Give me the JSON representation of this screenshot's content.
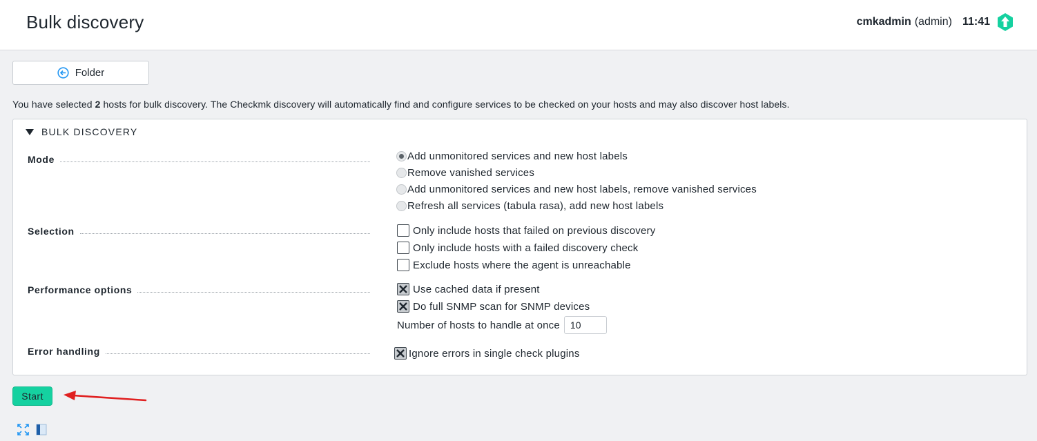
{
  "header": {
    "title": "Bulk discovery",
    "user_name": "cmkadmin",
    "user_role": "(admin)",
    "time": "11:41",
    "status_icon": "green-up-arrow-icon"
  },
  "toolbar": {
    "folder_label": "Folder",
    "folder_icon": "back-circle-icon"
  },
  "info": {
    "before": "You have selected ",
    "count": "2",
    "after": " hosts for bulk discovery. The Checkmk discovery will automatically find and configure services to be checked on your hosts and may also discover host labels."
  },
  "panel": {
    "title": "BULK DISCOVERY",
    "mode": {
      "label": "Mode",
      "options": [
        "Add unmonitored services and new host labels",
        "Remove vanished services",
        "Add unmonitored services and new host labels, remove vanished services",
        "Refresh all services (tabula rasa), add new host labels"
      ],
      "selected_index": 0
    },
    "selection": {
      "label": "Selection",
      "options": [
        "Only include hosts that failed on previous discovery",
        "Only include hosts with a failed discovery check",
        "Exclude hosts where the agent is unreachable"
      ],
      "checked": [
        false,
        false,
        false
      ]
    },
    "performance": {
      "label": "Performance options",
      "options": [
        "Use cached data if present",
        "Do full SNMP scan for SNMP devices"
      ],
      "checked": [
        true,
        true
      ],
      "hosts_at_once_label": "Number of hosts to handle at once",
      "hosts_at_once_value": "10"
    },
    "error_handling": {
      "label": "Error handling",
      "option": "Ignore errors in single check plugins",
      "checked": true
    }
  },
  "actions": {
    "start_label": "Start"
  },
  "colors": {
    "accent_green": "#15d1a0",
    "annotation_red": "#e02020"
  }
}
